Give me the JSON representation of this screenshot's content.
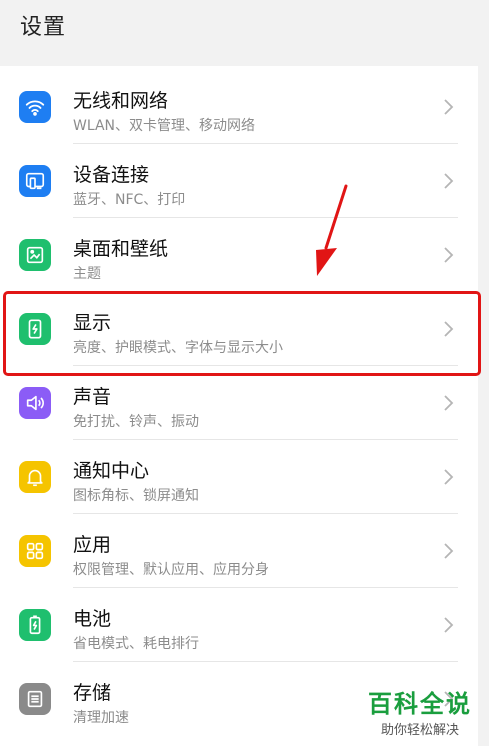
{
  "header": {
    "title": "设置"
  },
  "items": [
    {
      "title": "无线和网络",
      "subtitle": "WLAN、双卡管理、移动网络",
      "icon": "wifi-icon",
      "color": "#1e7ef2"
    },
    {
      "title": "设备连接",
      "subtitle": "蓝牙、NFC、打印",
      "icon": "device-connect-icon",
      "color": "#1e7ef2"
    },
    {
      "title": "桌面和壁纸",
      "subtitle": "主题",
      "icon": "wallpaper-icon",
      "color": "#1fbf6e"
    },
    {
      "title": "显示",
      "subtitle": "亮度、护眼模式、字体与显示大小",
      "icon": "display-icon",
      "color": "#1fbf6e"
    },
    {
      "title": "声音",
      "subtitle": "免打扰、铃声、振动",
      "icon": "sound-icon",
      "color": "#8b5cf6"
    },
    {
      "title": "通知中心",
      "subtitle": "图标角标、锁屏通知",
      "icon": "bell-icon",
      "color": "#f5c400"
    },
    {
      "title": "应用",
      "subtitle": "权限管理、默认应用、应用分身",
      "icon": "apps-grid-icon",
      "color": "#f5c400"
    },
    {
      "title": "电池",
      "subtitle": "省电模式、耗电排行",
      "icon": "battery-icon",
      "color": "#1fbf6e"
    },
    {
      "title": "存储",
      "subtitle": "清理加速",
      "icon": "storage-icon",
      "color": "#8a8a8a"
    }
  ],
  "highlight_color": "#e11515",
  "watermark": {
    "main": "百科全说",
    "sub": "助你轻松解决"
  }
}
